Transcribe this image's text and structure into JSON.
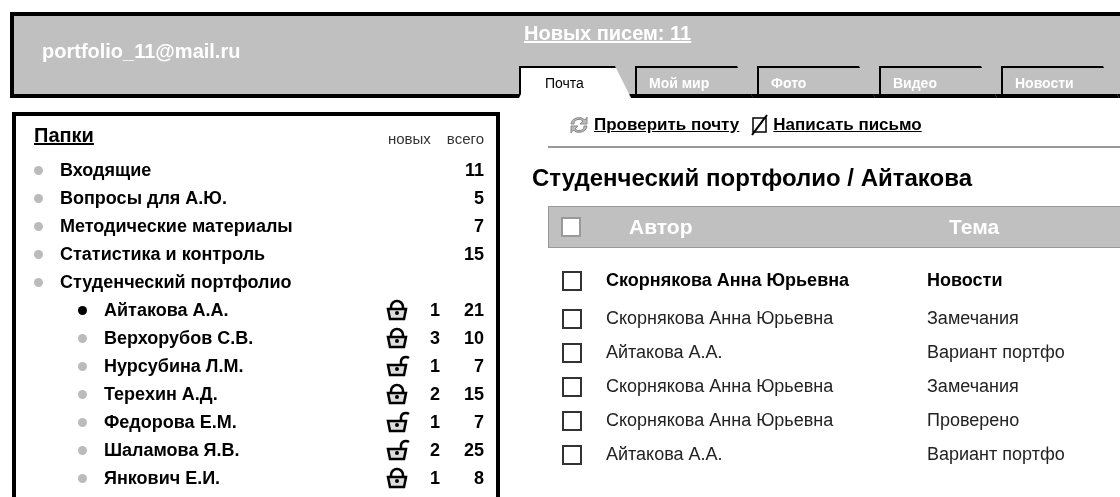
{
  "header": {
    "account": "portfolio_11@mail.ru",
    "new_mail_link": "Новых писем: 11"
  },
  "tabs": [
    {
      "label": "Почта",
      "selected": true
    },
    {
      "label": "Мой мир",
      "selected": false
    },
    {
      "label": "Фото",
      "selected": false
    },
    {
      "label": "Видео",
      "selected": false
    },
    {
      "label": "Новости",
      "selected": false
    }
  ],
  "folders": {
    "title": "Папки",
    "col_new": "новых",
    "col_total": "всего",
    "items": [
      {
        "name": "Входящие",
        "total": "11",
        "selected": false
      },
      {
        "name": "Вопросы для А.Ю.",
        "total": "5",
        "selected": false
      },
      {
        "name": "Методические материалы",
        "total": "7",
        "selected": false
      },
      {
        "name": "Статистика и контроль",
        "total": "15",
        "selected": false
      },
      {
        "name": "Студенческий портфолио",
        "selected": false,
        "children": [
          {
            "name": "Айтакова А.А.",
            "locked": true,
            "new": "1",
            "total": "21",
            "selected": true
          },
          {
            "name": "Верхорубов С.В.",
            "locked": true,
            "new": "3",
            "total": "10",
            "selected": false
          },
          {
            "name": "Нурсубина Л.М.",
            "locked": false,
            "new": "1",
            "total": "7",
            "selected": false
          },
          {
            "name": "Терехин А.Д.",
            "locked": true,
            "new": "2",
            "total": "15",
            "selected": false
          },
          {
            "name": "Федорова Е.М.",
            "locked": false,
            "new": "1",
            "total": "7",
            "selected": false
          },
          {
            "name": "Шаламова Я.В.",
            "locked": false,
            "new": "2",
            "total": "25",
            "selected": false
          },
          {
            "name": "Янкович Е.И.",
            "locked": true,
            "new": "1",
            "total": "8",
            "selected": false
          }
        ]
      }
    ]
  },
  "toolbar": [
    "Проверить почту",
    "Написать письмо"
  ],
  "heading": "Студенческий портфолио / Айтакова",
  "table": {
    "columns": [
      "Автор",
      "Тема"
    ],
    "select_all_checked": false,
    "rows": [
      {
        "author": "Скорнякова Анна Юрьевна",
        "subject": "Новости",
        "unread": true,
        "checked": false
      },
      {
        "author": "Скорнякова  Анна  Юрьевна",
        "subject": "Замечания",
        "unread": false,
        "checked": false
      },
      {
        "author": "Айтакова А.А.",
        "subject": "Вариант портфо",
        "unread": false,
        "checked": false
      },
      {
        "author": "Скорнякова  Анна  Юрьевна",
        "subject": "Замечания",
        "unread": false,
        "checked": false
      },
      {
        "author": "Скорнякова  Анна  Юрьевна",
        "subject": "Проверено",
        "unread": false,
        "checked": false
      },
      {
        "author": "Айтакова А.А.",
        "subject": "Вариант портфо",
        "unread": false,
        "checked": false
      }
    ]
  }
}
